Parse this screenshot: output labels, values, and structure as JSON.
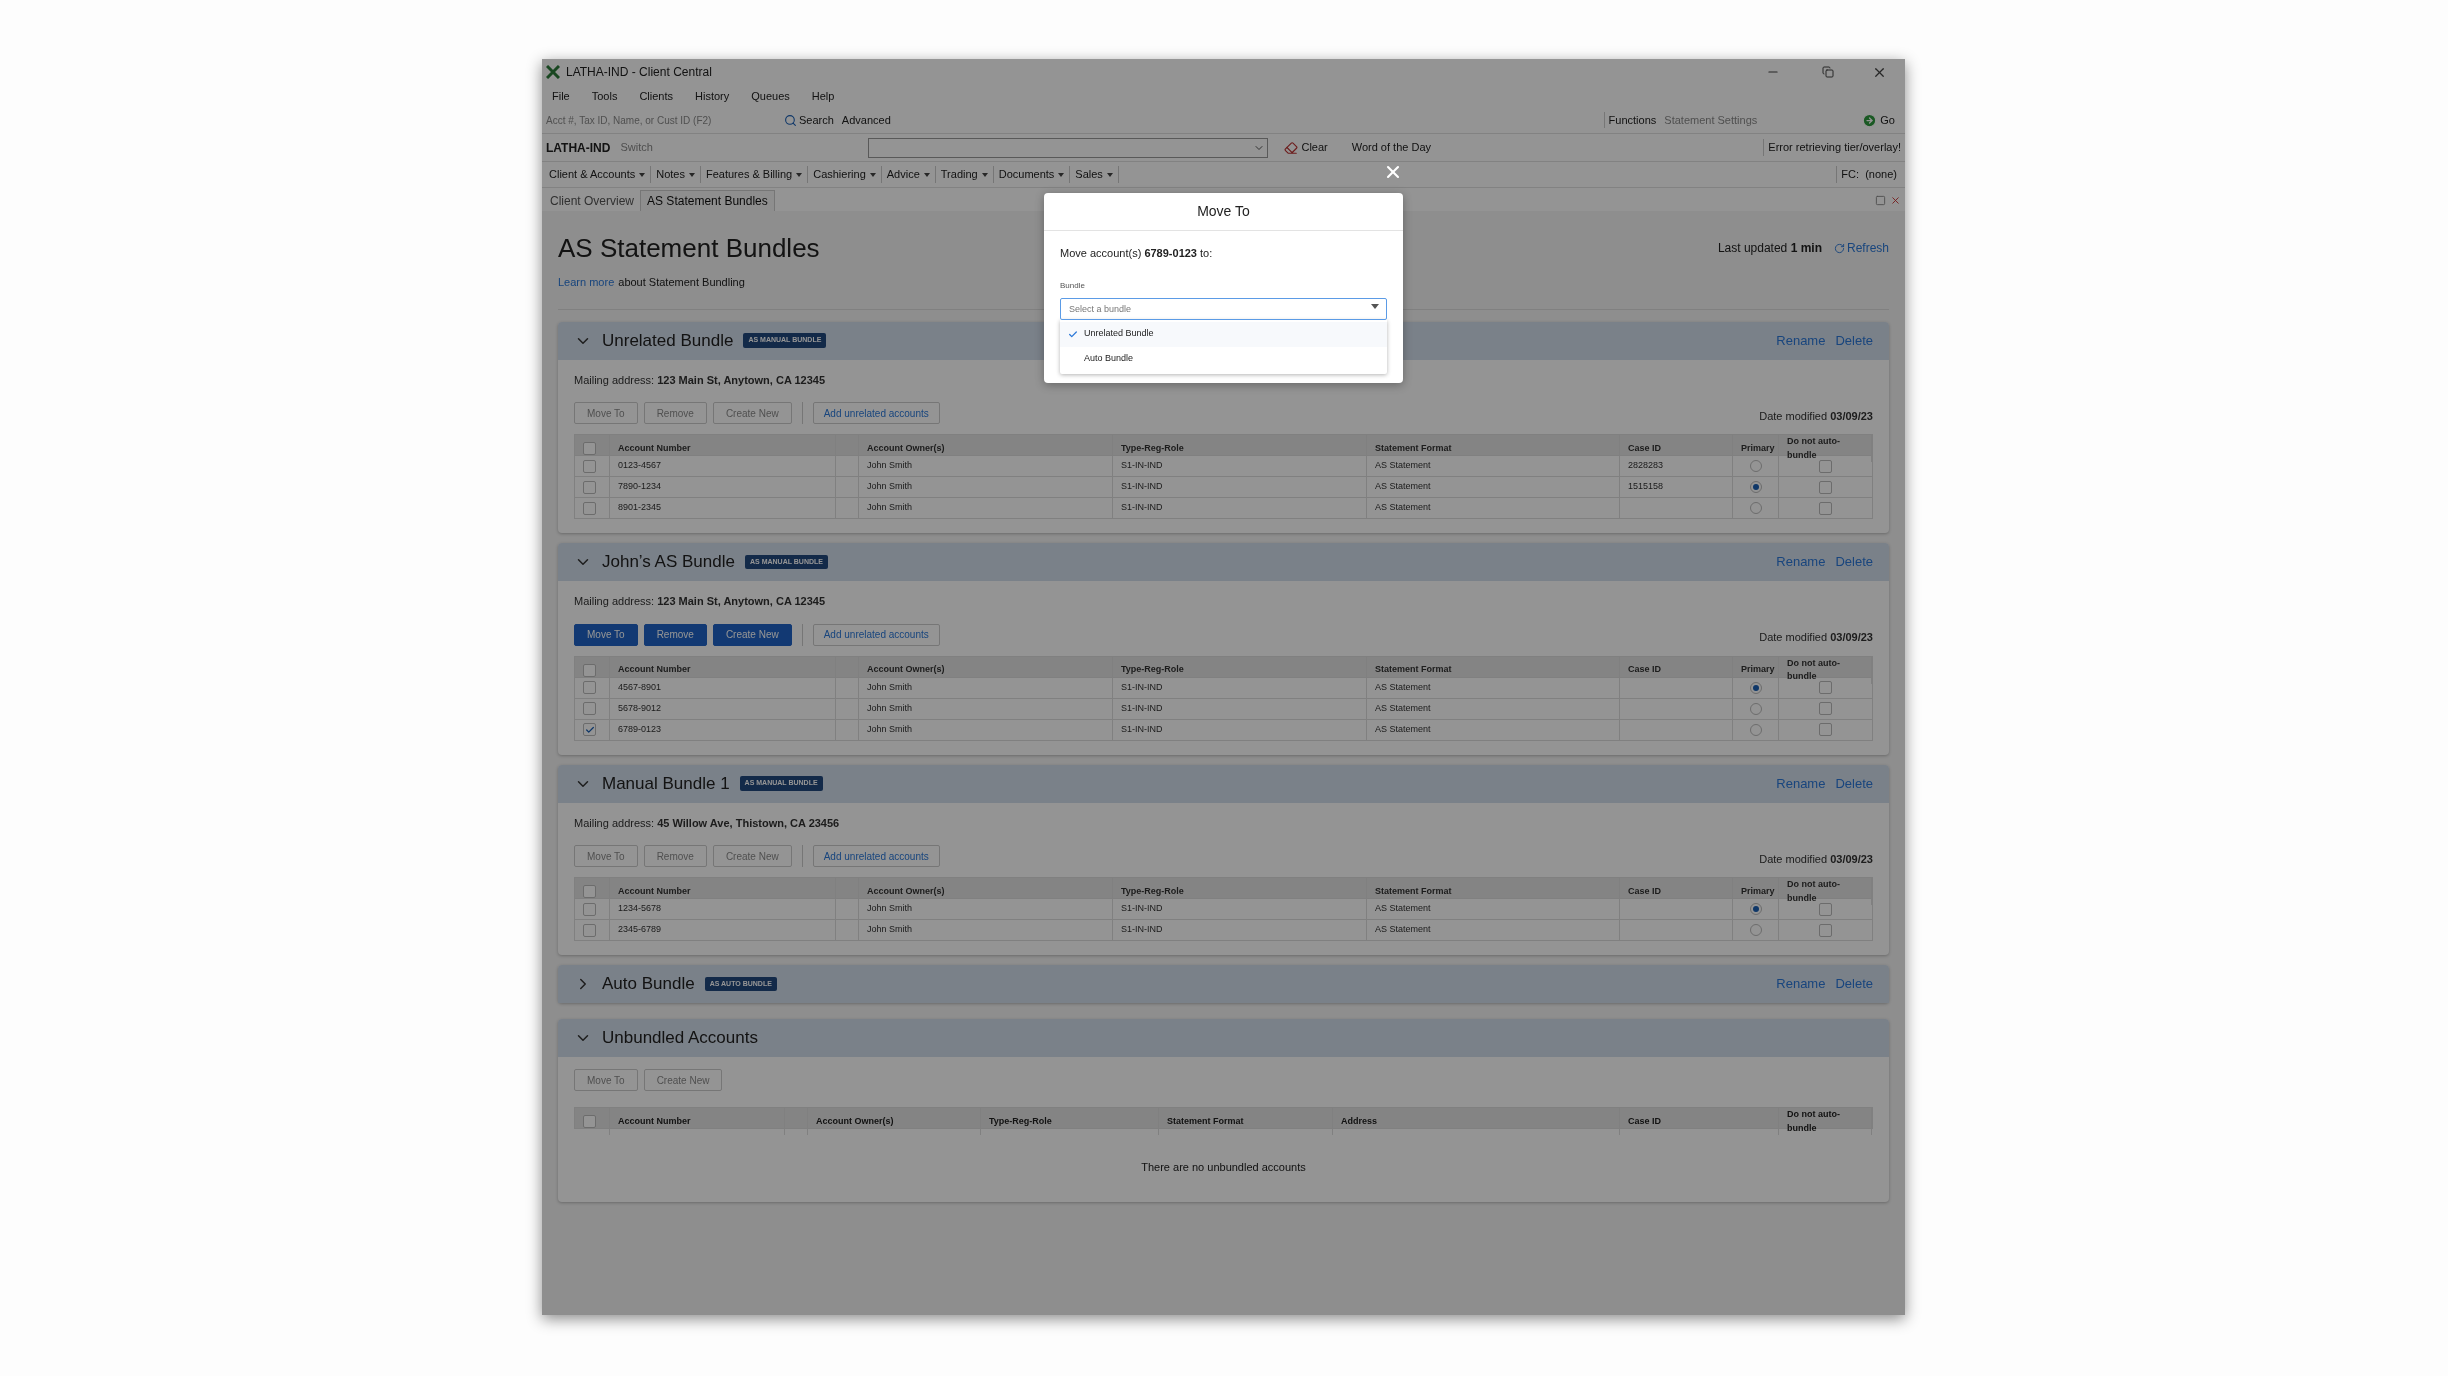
{
  "window": {
    "title": "LATHA-IND - Client Central"
  },
  "menu": [
    "File",
    "Tools",
    "Clients",
    "History",
    "Queues",
    "Help"
  ],
  "search_bar": {
    "placeholder": "Acct #, Tax ID, Name, or Cust ID (F2)",
    "search": "Search",
    "advanced": "Advanced",
    "functions": "Functions",
    "statement_settings": {
      "label": "Statement Settings",
      "disabled": true
    },
    "go": "Go"
  },
  "client_bar": {
    "client": "LATHA-IND",
    "switch": "Switch",
    "clear": "Clear",
    "word_of_day": "Word of the Day",
    "error": "Error retrieving tier/overlay!"
  },
  "nav_menus": [
    "Client & Accounts",
    "Notes",
    "Features & Billing",
    "Cashiering",
    "Advice",
    "Trading",
    "Documents",
    "Sales"
  ],
  "fc": "FC:  (none)",
  "tabs": [
    {
      "label": "Client Overview",
      "selected": false
    },
    {
      "label": "AS Statement Bundles",
      "selected": true
    }
  ],
  "page": {
    "title": "AS Statement Bundles",
    "learn_more": "Learn more",
    "learn_more_rest": "about Statement Bundling",
    "last_updated": "Last updated **1 min**",
    "refresh": "Refresh"
  },
  "bundles": [
    {
      "name": "Unrelated Bundle",
      "badge": "AS MANUAL BUNDLE",
      "expanded": true,
      "rename": "Rename",
      "delete": "Delete",
      "mailing": "Mailing address: **123 Main St, Anytown, CA 12345**",
      "buttons": [
        {
          "label": "Move To",
          "disabled": true
        },
        {
          "label": "Remove",
          "disabled": true
        },
        {
          "label": "Create New",
          "disabled": true
        }
      ],
      "add": "Add unrelated accounts",
      "date_modified": "Date modified **03/09/23**",
      "columns": [
        "Account Number",
        "Account Owner(s)",
        "Type-Reg-Role",
        "Statement Format",
        "Case ID",
        "Primary",
        "Do not auto-bundle"
      ],
      "select_all": false,
      "rows": [
        {
          "checked": false,
          "account": "0123-4567",
          "owner": "John Smith",
          "type": "S1-IN-IND",
          "format": "AS Statement",
          "case_id": "2828283",
          "primary": false,
          "no_auto": false
        },
        {
          "checked": false,
          "account": "7890-1234",
          "owner": "John Smith",
          "type": "S1-IN-IND",
          "format": "AS Statement",
          "case_id": "1515158",
          "primary": true,
          "no_auto": false
        },
        {
          "checked": false,
          "account": "8901-2345",
          "owner": "John Smith",
          "type": "S1-IN-IND",
          "format": "AS Statement",
          "primary": false,
          "no_auto": false
        }
      ]
    },
    {
      "name": "John’s AS Bundle",
      "badge": "AS MANUAL BUNDLE",
      "expanded": true,
      "rename": "Rename",
      "delete": "Delete",
      "mailing": "Mailing address: **123 Main St, Anytown, CA 12345**",
      "buttons": [
        {
          "label": "Move To",
          "disabled": false
        },
        {
          "label": "Remove",
          "disabled": false
        },
        {
          "label": "Create New",
          "disabled": false
        }
      ],
      "add": "Add unrelated accounts",
      "date_modified": "Date modified **03/09/23**",
      "columns": [
        "Account Number",
        "Account Owner(s)",
        "Type-Reg-Role",
        "Statement Format",
        "Case ID",
        "Primary",
        "Do not auto-bundle"
      ],
      "select_all": false,
      "rows": [
        {
          "checked": false,
          "account": "4567-8901",
          "owner": "John Smith",
          "type": "S1-IN-IND",
          "format": "AS Statement",
          "primary": true,
          "no_auto": false
        },
        {
          "checked": false,
          "account": "5678-9012",
          "owner": "John Smith",
          "type": "S1-IN-IND",
          "format": "AS Statement",
          "primary": false,
          "no_auto": false
        },
        {
          "checked": true,
          "account": "6789-0123",
          "owner": "John Smith",
          "type": "S1-IN-IND",
          "format": "AS Statement",
          "primary": false,
          "no_auto": false
        }
      ]
    },
    {
      "name": "Manual Bundle 1",
      "badge": "AS MANUAL BUNDLE",
      "expanded": true,
      "rename": "Rename",
      "delete": "Delete",
      "mailing": "Mailing address: **45 Willow Ave, Thistown, CA 23456**",
      "buttons": [
        {
          "label": "Move To",
          "disabled": true
        },
        {
          "label": "Remove",
          "disabled": true
        },
        {
          "label": "Create New",
          "disabled": true
        }
      ],
      "add": "Add unrelated accounts",
      "date_modified": "Date modified **03/09/23**",
      "columns": [
        "Account Number",
        "Account Owner(s)",
        "Type-Reg-Role",
        "Statement Format",
        "Case ID",
        "Primary",
        "Do not auto-bundle"
      ],
      "select_all": false,
      "rows": [
        {
          "checked": false,
          "account": "1234-5678",
          "owner": "John Smith",
          "type": "S1-IN-IND",
          "format": "AS Statement",
          "primary": true,
          "no_auto": false
        },
        {
          "checked": false,
          "account": "2345-6789",
          "owner": "John Smith",
          "type": "S1-IN-IND",
          "format": "AS Statement",
          "primary": false,
          "no_auto": false
        }
      ]
    },
    {
      "name": "Auto Bundle",
      "badge": "AS AUTO BUNDLE",
      "expanded": false,
      "rename": "Rename",
      "delete": "Delete"
    }
  ],
  "unbundled": {
    "name": "Unbundled Accounts",
    "expanded": true,
    "buttons": [
      {
        "label": "Move To",
        "disabled": true
      },
      {
        "label": "Create New",
        "disabled": true
      }
    ],
    "columns": [
      "Account Number",
      "Account Owner(s)",
      "Type-Reg-Role",
      "Statement Format",
      "Address",
      "Case ID",
      "Do not auto-bundle"
    ],
    "select_all": false,
    "empty": "There are no unbundled accounts"
  },
  "modal": {
    "title": "Move To",
    "prompt": "Move account(s) **6789-0123** to:",
    "field_label": "Bundle",
    "placeholder": "Select a bundle",
    "options": [
      {
        "label": "Unrelated Bundle",
        "selected": true
      },
      {
        "label": "Auto Bundle",
        "selected": false
      }
    ]
  }
}
